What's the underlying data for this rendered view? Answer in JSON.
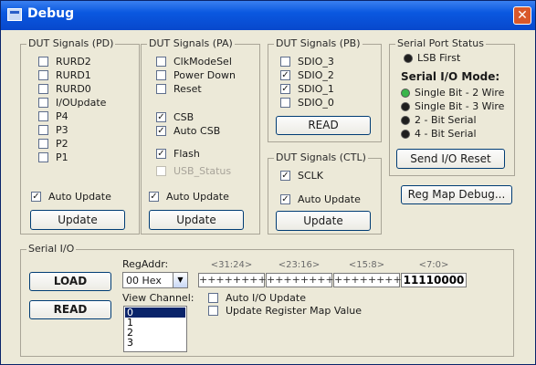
{
  "window": {
    "title": "Debug",
    "close_glyph": "✕"
  },
  "groups": {
    "pd": {
      "title": "DUT Signals (PD)",
      "items": [
        {
          "label": "RURD2",
          "checked": false
        },
        {
          "label": "RURD1",
          "checked": false
        },
        {
          "label": "RURD0",
          "checked": false
        },
        {
          "label": "I/OUpdate",
          "checked": false
        },
        {
          "label": "P4",
          "checked": false
        },
        {
          "label": "P3",
          "checked": false
        },
        {
          "label": "P2",
          "checked": false
        },
        {
          "label": "P1",
          "checked": false
        }
      ],
      "auto_update": "Auto Update",
      "update": "Update"
    },
    "pa": {
      "title": "DUT Signals (PA)",
      "items": [
        {
          "label": "ClkModeSel",
          "checked": false
        },
        {
          "label": "Power Down",
          "checked": false
        },
        {
          "label": "Reset",
          "checked": false
        },
        {
          "label": "CSB",
          "checked": true
        },
        {
          "label": "Auto CSB",
          "checked": true
        },
        {
          "label": "Flash",
          "checked": true
        },
        {
          "label": "USB_Status",
          "checked": false,
          "disabled": true
        }
      ],
      "auto_update": "Auto Update",
      "update": "Update"
    },
    "pb": {
      "title": "DUT Signals (PB)",
      "items": [
        {
          "label": "SDIO_3",
          "checked": false
        },
        {
          "label": "SDIO_2",
          "checked": true
        },
        {
          "label": "SDIO_1",
          "checked": true
        },
        {
          "label": "SDIO_0",
          "checked": false
        }
      ],
      "read": "READ"
    },
    "ctl": {
      "title": "DUT Signals (CTL)",
      "sclk": "SCLK",
      "auto_update": "Auto Update",
      "update": "Update"
    },
    "sps": {
      "title": "Serial Port Status",
      "lsb_first": "LSB First",
      "mode_title": "Serial I/O Mode:",
      "modes": [
        {
          "label": "Single Bit - 2 Wire",
          "selected": true
        },
        {
          "label": "Single Bit - 3 Wire",
          "selected": false
        },
        {
          "label": "2 - Bit Serial",
          "selected": false
        },
        {
          "label": "4 - Bit Serial",
          "selected": false
        }
      ],
      "reset": "Send I/O Reset"
    }
  },
  "reg_map_debug": "Reg Map Debug...",
  "serial_io": {
    "title": "Serial I/O",
    "load": "LOAD",
    "read": "READ",
    "reg_addr_label": "RegAddr:",
    "reg_addr_value": "00  Hex",
    "view_channel_label": "View Channel:",
    "channels": [
      "0",
      "1",
      "2",
      "3"
    ],
    "selected_channel": "0",
    "bit_headers": [
      "<31:24>",
      "<23:16>",
      "<15:8>",
      "<7:0>"
    ],
    "bit_values": [
      "++++++++",
      "++++++++",
      "++++++++",
      "11110000"
    ],
    "auto_io_update": "Auto I/O Update",
    "update_reg_map": "Update Register Map Value"
  },
  "colors": {
    "title_bar": "#0a58e0",
    "window_bg": "#ece9d8",
    "close": "#d9582a",
    "selection": "#0a246a"
  }
}
